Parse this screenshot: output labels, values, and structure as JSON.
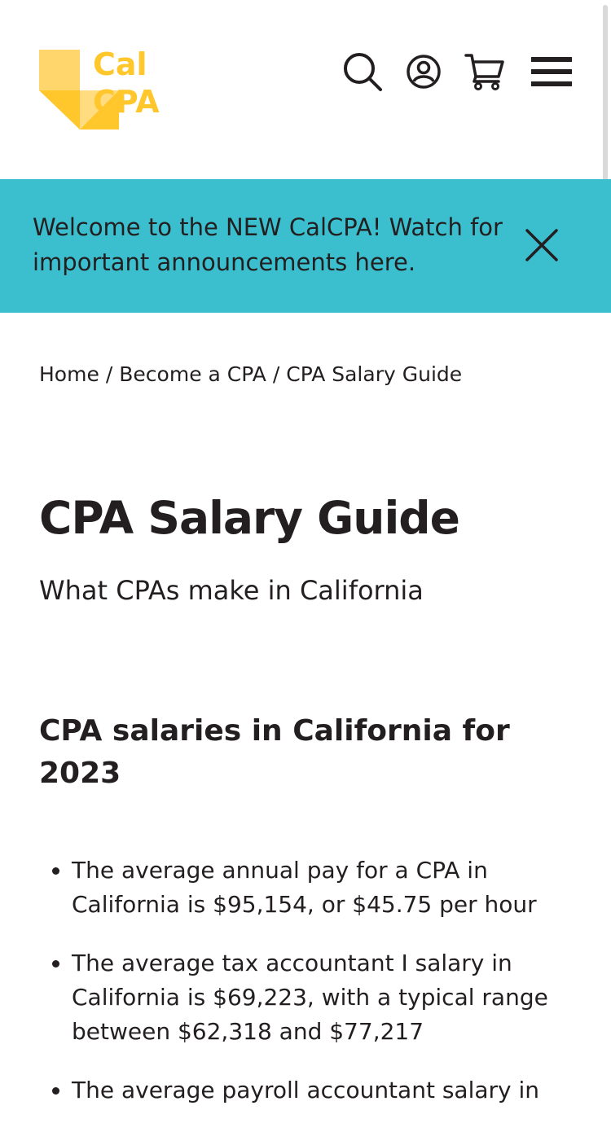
{
  "header": {
    "logo": {
      "line1": "Cal",
      "line2": "CPA",
      "color": "#ffc72c"
    },
    "icons": [
      "search-icon",
      "account-icon",
      "cart-icon",
      "menu-icon"
    ]
  },
  "banner": {
    "text": "Welcome to the NEW CalCPA! Watch for important announcements here.",
    "background": "#3bbfce"
  },
  "breadcrumb": {
    "items": [
      "Home",
      "Become a CPA",
      "CPA Salary Guide"
    ],
    "separator": "/"
  },
  "page": {
    "title": "CPA Salary Guide",
    "subtitle": "What CPAs make in California"
  },
  "section": {
    "heading": "CPA salaries in California for 2023",
    "bullets": [
      "The average annual pay for a CPA in California is $95,154, or $45.75 per hour",
      "The average tax accountant I salary in California is $69,223, with a typical range between $62,318 and $77,217",
      "The average payroll accountant salary in"
    ]
  }
}
